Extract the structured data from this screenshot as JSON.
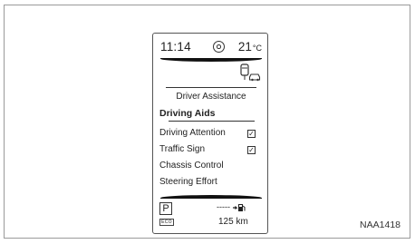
{
  "figure_code": "NAA1418",
  "status": {
    "time": "11:14",
    "temperature": "21",
    "temperature_unit": "°C"
  },
  "menu": {
    "title": "Driver Assistance",
    "selected": "Driving Aids",
    "items": [
      {
        "label": "Driving Attention",
        "checked": true
      },
      {
        "label": "Traffic Sign",
        "checked": true
      },
      {
        "label": "Chassis Control"
      },
      {
        "label": "Steering Effort"
      }
    ]
  },
  "footer": {
    "gear": "P",
    "eco_badge": "ECO",
    "fuel_dashes": "-----",
    "range": "125 km"
  },
  "icons": {
    "top": "vehicle-status-icon",
    "car": "driver-assistance-car-icon",
    "fuel": "fuel-pump-icon"
  },
  "colors": {
    "frame": "#9a9a9a",
    "display_border": "#555555",
    "text": "#222222"
  }
}
